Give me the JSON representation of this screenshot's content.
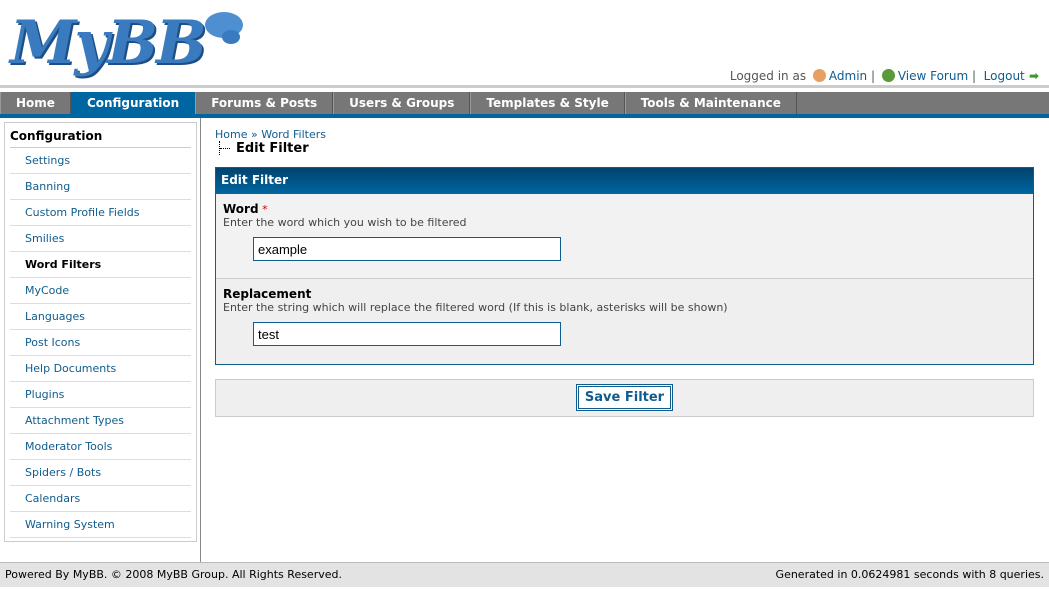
{
  "header": {
    "logo": "MyBB",
    "logged_in_as": "Logged in as",
    "user": "Admin",
    "view_forum": "View Forum",
    "logout": "Logout"
  },
  "nav": [
    "Home",
    "Configuration",
    "Forums & Posts",
    "Users & Groups",
    "Templates & Style",
    "Tools & Maintenance"
  ],
  "sidebar": {
    "title": "Configuration",
    "items": [
      "Settings",
      "Banning",
      "Custom Profile Fields",
      "Smilies",
      "Word Filters",
      "MyCode",
      "Languages",
      "Post Icons",
      "Help Documents",
      "Plugins",
      "Attachment Types",
      "Moderator Tools",
      "Spiders / Bots",
      "Calendars",
      "Warning System"
    ]
  },
  "breadcrumb": {
    "home": "Home",
    "sep": "»",
    "section": "Word Filters",
    "current": "Edit Filter"
  },
  "form": {
    "title": "Edit Filter",
    "word": {
      "label": "Word",
      "required": "*",
      "desc": "Enter the word which you wish to be filtered",
      "value": "example"
    },
    "replacement": {
      "label": "Replacement",
      "desc": "Enter the string which will replace the filtered word (If this is blank, asterisks will be shown)",
      "value": "test"
    },
    "save": "Save Filter"
  },
  "footer": {
    "left": "Powered By MyBB. © 2008 MyBB Group. All Rights Reserved.",
    "right": "Generated in 0.0624981 seconds with 8 queries."
  }
}
